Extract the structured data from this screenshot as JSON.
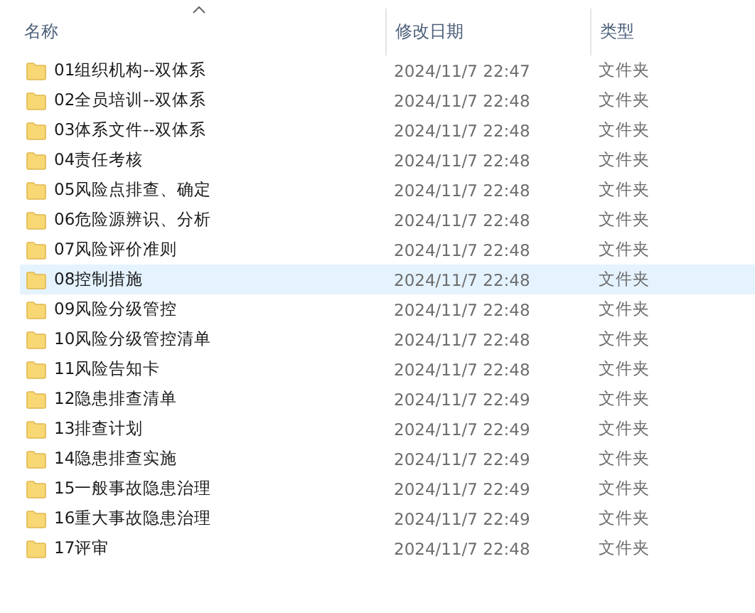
{
  "columns": [
    "名称",
    "修改日期",
    "类型"
  ],
  "rows": [
    {
      "name": "01组织机构--双体系",
      "date": "2024/11/7 22:47",
      "type": "文件夹",
      "selected": false
    },
    {
      "name": "02全员培训--双体系",
      "date": "2024/11/7 22:48",
      "type": "文件夹",
      "selected": false
    },
    {
      "name": "03体系文件--双体系",
      "date": "2024/11/7 22:48",
      "type": "文件夹",
      "selected": false
    },
    {
      "name": "04责任考核",
      "date": "2024/11/7 22:48",
      "type": "文件夹",
      "selected": false
    },
    {
      "name": "05风险点排查、确定",
      "date": "2024/11/7 22:48",
      "type": "文件夹",
      "selected": false
    },
    {
      "name": "06危险源辨识、分析",
      "date": "2024/11/7 22:48",
      "type": "文件夹",
      "selected": false
    },
    {
      "name": "07风险评价准则",
      "date": "2024/11/7 22:48",
      "type": "文件夹",
      "selected": false
    },
    {
      "name": "08控制措施",
      "date": "2024/11/7 22:48",
      "type": "文件夹",
      "selected": true
    },
    {
      "name": "09风险分级管控",
      "date": "2024/11/7 22:48",
      "type": "文件夹",
      "selected": false
    },
    {
      "name": "10风险分级管控清单",
      "date": "2024/11/7 22:48",
      "type": "文件夹",
      "selected": false
    },
    {
      "name": "11风险告知卡",
      "date": "2024/11/7 22:48",
      "type": "文件夹",
      "selected": false
    },
    {
      "name": "12隐患排查清单",
      "date": "2024/11/7 22:49",
      "type": "文件夹",
      "selected": false
    },
    {
      "name": "13排查计划",
      "date": "2024/11/7 22:49",
      "type": "文件夹",
      "selected": false
    },
    {
      "name": "14隐患排查实施",
      "date": "2024/11/7 22:49",
      "type": "文件夹",
      "selected": false
    },
    {
      "name": "15一般事故隐患治理",
      "date": "2024/11/7 22:49",
      "type": "文件夹",
      "selected": false
    },
    {
      "name": "16重大事故隐患治理",
      "date": "2024/11/7 22:49",
      "type": "文件夹",
      "selected": false
    },
    {
      "name": "17评审",
      "date": "2024/11/7 22:48",
      "type": "文件夹",
      "selected": false
    }
  ]
}
